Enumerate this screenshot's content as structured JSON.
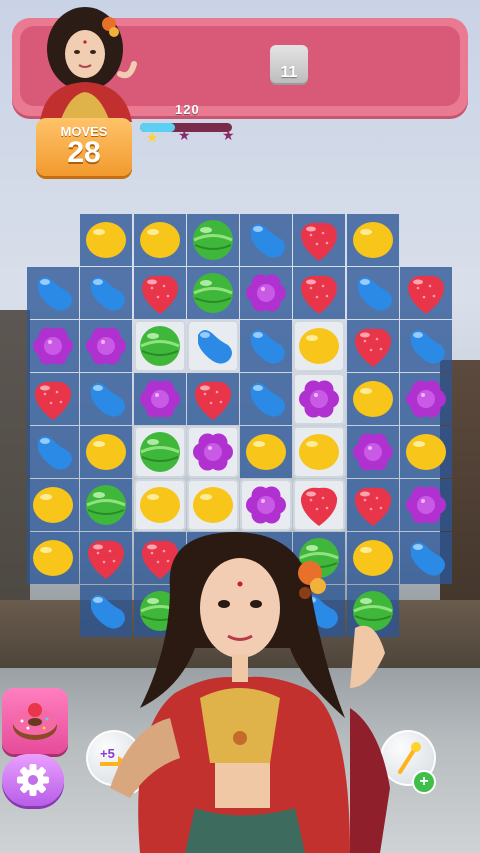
{
  "goal": {
    "count": "11",
    "icon": "grey-block-icon"
  },
  "moves": {
    "label": "MOVES",
    "value": "28"
  },
  "score": {
    "value": "120",
    "progress": 0.38,
    "stars": [
      "star-1",
      "star-2",
      "star-3"
    ]
  },
  "colors": {
    "yellow": "#f8c51a",
    "green": "#3fb73a",
    "blue": "#2a8ae6",
    "red": "#e8354a",
    "purple": "#b030d0",
    "tile_dark": "#2b5696",
    "tile_light": "#e8ecf1",
    "banner": "#d85a78",
    "moves_orange": "#f29a2e"
  },
  "board": {
    "rows": [
      [
        "",
        "yellow-lemon",
        "yellow-lemon",
        "green-ball",
        "blue-bean",
        "red-strawberry",
        "yellow-lemon",
        ""
      ],
      [
        "blue-bean",
        "blue-bean",
        "red-strawberry",
        "green-ball",
        "purple-flower",
        "red-strawberry",
        "blue-bean",
        "red-strawberry"
      ],
      [
        "purple-flower",
        "purple-flower",
        "green-ball",
        "blue-bean",
        "blue-bean",
        "yellow-lemon",
        "red-strawberry",
        "blue-bean"
      ],
      [
        "red-strawberry",
        "blue-bean",
        "purple-flower",
        "red-strawberry",
        "blue-bean",
        "purple-flower",
        "yellow-lemon",
        "purple-flower"
      ],
      [
        "blue-bean",
        "yellow-lemon",
        "green-ball",
        "purple-flower",
        "yellow-lemon",
        "yellow-lemon",
        "purple-flower",
        "yellow-lemon"
      ],
      [
        "yellow-lemon",
        "green-ball",
        "yellow-lemon",
        "yellow-lemon",
        "purple-flower",
        "red-strawberry",
        "red-strawberry",
        "purple-flower"
      ],
      [
        "yellow-lemon",
        "red-strawberry",
        "red-strawberry",
        "blue-bean",
        "",
        "green-ball",
        "yellow-lemon",
        "blue-bean"
      ],
      [
        "",
        "blue-bean",
        "green-ball",
        "purple-flower",
        "",
        "blue-bean",
        "green-ball",
        ""
      ]
    ],
    "light_tiles": [
      [
        2,
        2
      ],
      [
        2,
        3
      ],
      [
        2,
        5
      ],
      [
        3,
        5
      ],
      [
        4,
        2
      ],
      [
        4,
        3
      ],
      [
        4,
        5
      ],
      [
        5,
        2
      ],
      [
        5,
        3
      ],
      [
        5,
        4
      ],
      [
        5,
        5
      ]
    ]
  },
  "boosters": {
    "left": [
      {
        "name": "donut-booster",
        "icon": "donut-icon"
      },
      {
        "name": "settings",
        "icon": "gear-icon"
      }
    ],
    "bubbles": [
      {
        "label": "+5",
        "icon": "plus-five-arrow-icon"
      },
      {
        "label": "",
        "icon": "hammer-icon"
      },
      {
        "label": "",
        "icon": "wand-icon"
      }
    ]
  }
}
